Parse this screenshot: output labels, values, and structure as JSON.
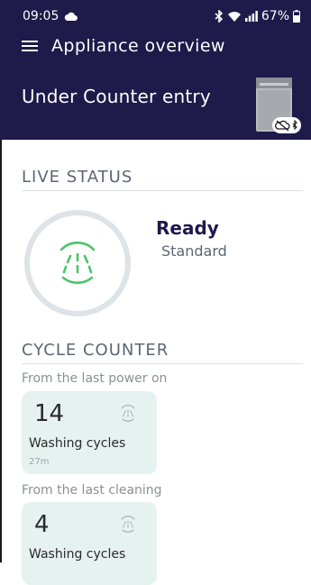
{
  "status_bar": {
    "time": "09:05",
    "battery": "67%"
  },
  "header": {
    "title": "Appliance overview",
    "device_name": "Under Counter entry"
  },
  "live_status": {
    "section_title": "LIVE STATUS",
    "state": "Ready",
    "program": "Standard"
  },
  "cycle_counter": {
    "section_title": "CYCLE COUNTER",
    "blocks": [
      {
        "caption": "From the last power on",
        "count": "14",
        "label": "Washing cycles",
        "time": "27m"
      },
      {
        "caption": "From the last cleaning",
        "count": "4",
        "label": "Washing cycles"
      }
    ]
  },
  "colors": {
    "header_bg": "#1e1a4a",
    "accent_green": "#4cc36a",
    "card_bg": "#e6f2ef"
  },
  "icons": [
    "cloud-icon",
    "bluetooth-icon",
    "wifi-icon",
    "signal-icon",
    "battery-icon",
    "menu-icon",
    "dishwasher-image",
    "cloud-off-icon",
    "spray-icon"
  ]
}
